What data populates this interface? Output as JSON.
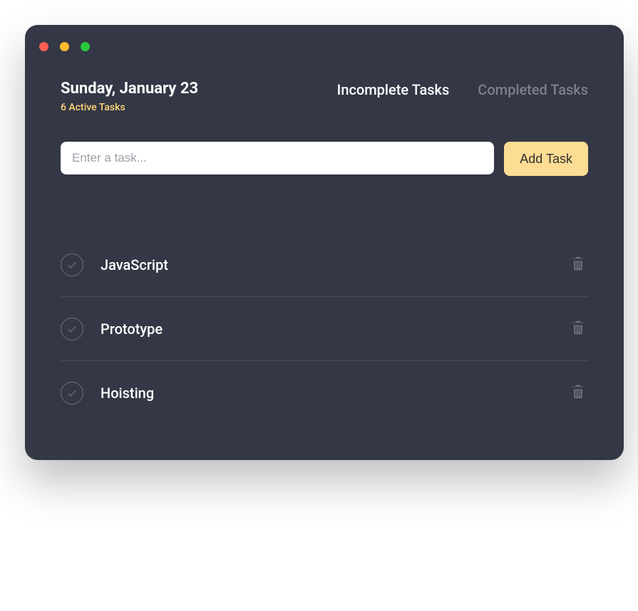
{
  "header": {
    "date": "Sunday, January 23",
    "active_count_text": "6 Active Tasks"
  },
  "tabs": {
    "incomplete": "Incomplete Tasks",
    "completed": "Completed Tasks"
  },
  "input": {
    "placeholder": "Enter a task...",
    "add_button": "Add Task"
  },
  "tasks": [
    {
      "label": "JavaScript"
    },
    {
      "label": "Prototype"
    },
    {
      "label": "Hoisting"
    }
  ]
}
